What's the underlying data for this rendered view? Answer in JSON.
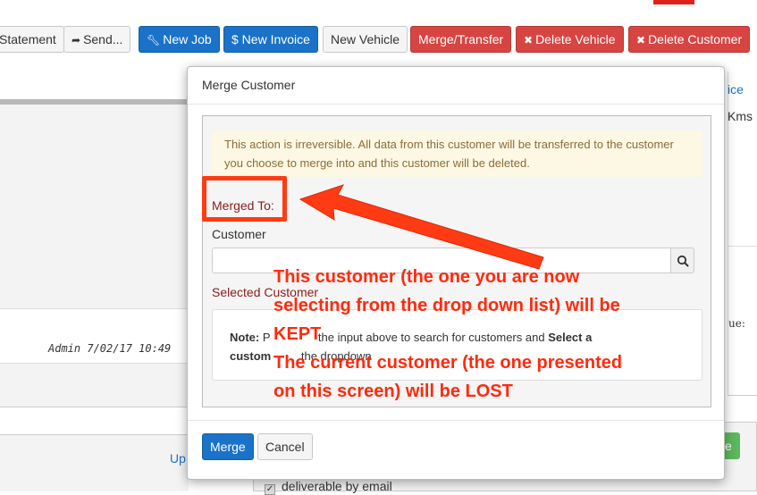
{
  "toolbar": {
    "statement": "Statement",
    "send": "Send...",
    "new_job": "New Job",
    "new_invoice": "$ New Invoice",
    "new_vehicle": "New Vehicle",
    "merge_transfer": "Merge/Transfer",
    "delete_vehicle": "Delete Vehicle",
    "delete_customer": "Delete Customer"
  },
  "background": {
    "right_link": "ice",
    "right_kms": "Kms",
    "right_ue": "ue:",
    "admin_line": "Admin  7/02/17 10:49",
    "update_link": "Up",
    "right_green_button": "e",
    "checkbox_label": "deliverable by email"
  },
  "modal": {
    "title": "Merge Customer",
    "warning": "This action is irreversible. All data from this customer will be transferred to the customer you choose to merge into and this customer will be deleted.",
    "merged_to_label": "Merged To:",
    "customer_label": "Customer",
    "customer_input_value": "",
    "selected_customer_label": "Selected Customer",
    "note_bold": "Note:",
    "note_text_1": "P",
    "note_text_2": "the input above to search for customers and",
    "note_bold_2": "Select a",
    "note_text_3": "custom",
    "note_text_4": "the dropdown",
    "merge_button": "Merge",
    "cancel_button": "Cancel"
  },
  "annotation": {
    "text": "This customer (the one you are now\nselecting from the drop down list) will be\nKEPT\nThe current customer (the one presented\non this screen) will be LOST"
  },
  "colors": {
    "primary": "#1a72c9",
    "danger": "#d64541",
    "annotation": "#ff3b14",
    "warning_bg": "#fcf8e3",
    "warning_text": "#8a6d3b",
    "label_red": "#8a1c1c"
  },
  "icons": {
    "send": "share-arrow-icon",
    "new_job": "wrench-icon",
    "delete": "times-icon",
    "search": "magnifier-icon"
  }
}
